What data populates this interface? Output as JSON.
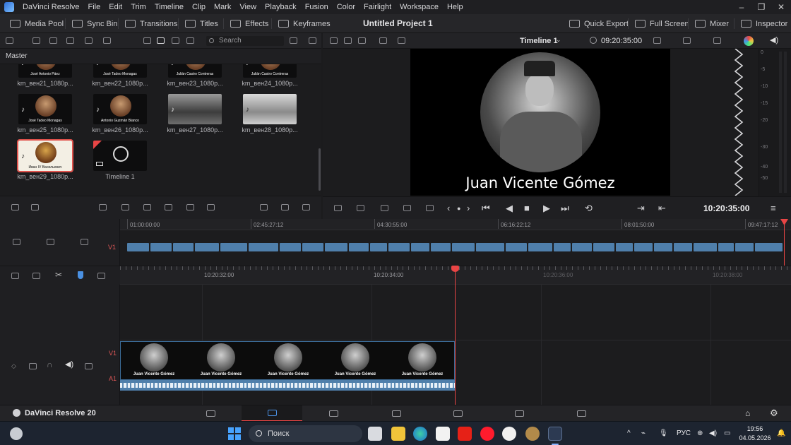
{
  "app": {
    "name": "DaVinci Resolve",
    "menu": [
      "File",
      "Edit",
      "Trim",
      "Timeline",
      "Clip",
      "Mark",
      "View",
      "Playback",
      "Fusion",
      "Color",
      "Fairlight",
      "Workspace",
      "Help"
    ],
    "window_controls": [
      "minimize",
      "restore",
      "close"
    ]
  },
  "toolbar": {
    "media_pool": "Media Pool",
    "sync_bin": "Sync Bin",
    "transitions": "Transitions",
    "titles": "Titles",
    "effects": "Effects",
    "keyframes": "Keyframes",
    "project_title": "Untitled Project 1",
    "quick_export": "Quick Export",
    "full_screen": "Full Screen",
    "mixer": "Mixer",
    "inspector": "Inspector"
  },
  "media_pool": {
    "search_placeholder": "Search",
    "bin": "Master",
    "clips": [
      {
        "name": "km_вен21_1080p...",
        "caption": "José Antonio Páez"
      },
      {
        "name": "km_вен22_1080p...",
        "caption": "José Tadeo Monagas"
      },
      {
        "name": "km_вен23_1080p...",
        "caption": "Julián Castro Contreras"
      },
      {
        "name": "km_вен24_1080p...",
        "caption": "Julián Castro Contreras"
      },
      {
        "name": "km_вен25_1080p...",
        "caption": "José Tadeo Monagas"
      },
      {
        "name": "km_вен26_1080p...",
        "caption": "Antonio Guzmán Blanco"
      },
      {
        "name": "km_вен27_1080p...",
        "caption": ""
      },
      {
        "name": "km_вен28_1080p...",
        "caption": ""
      },
      {
        "name": "km_вен29_1080p...",
        "caption": "Иван IV Васильевич",
        "selected": true
      },
      {
        "name": "Timeline 1",
        "caption": "",
        "is_timeline": true
      }
    ]
  },
  "viewer": {
    "timeline_name": "Timeline 1",
    "timecode_top": "09:20:35:00",
    "caption": "Juan Vicente Gómez",
    "timecode": "10:20:35:00",
    "meter_ticks": [
      "0",
      "-5",
      "-10",
      "-15",
      "-20",
      "-30",
      "-40",
      "-50"
    ]
  },
  "overview_ruler": [
    "01:00:00:00",
    "02:45:27:12",
    "04:30:55:00",
    "06:16:22:12",
    "08:01:50:00",
    "09:47:17:12"
  ],
  "detail_ruler": [
    "10:20:32:00",
    "10:20:34:00",
    "10:20:36:00",
    "10:20:38:00"
  ],
  "tracks": {
    "video": "V1",
    "audio": "A1",
    "frame_caption": "Juan Vicente Gómez"
  },
  "pagebar": {
    "brand": "DaVinci Resolve 20",
    "pages": [
      "media",
      "cut",
      "edit",
      "fusion",
      "color",
      "fairlight",
      "deliver"
    ],
    "active": "cut"
  },
  "taskbar": {
    "search": "Поиск",
    "lang": "РУС",
    "time": "19:56",
    "date": "04.05.2026"
  },
  "colors": {
    "accent": "#e84545",
    "clip_blue": "#4f7fab",
    "bg": "#1c1c1e"
  }
}
